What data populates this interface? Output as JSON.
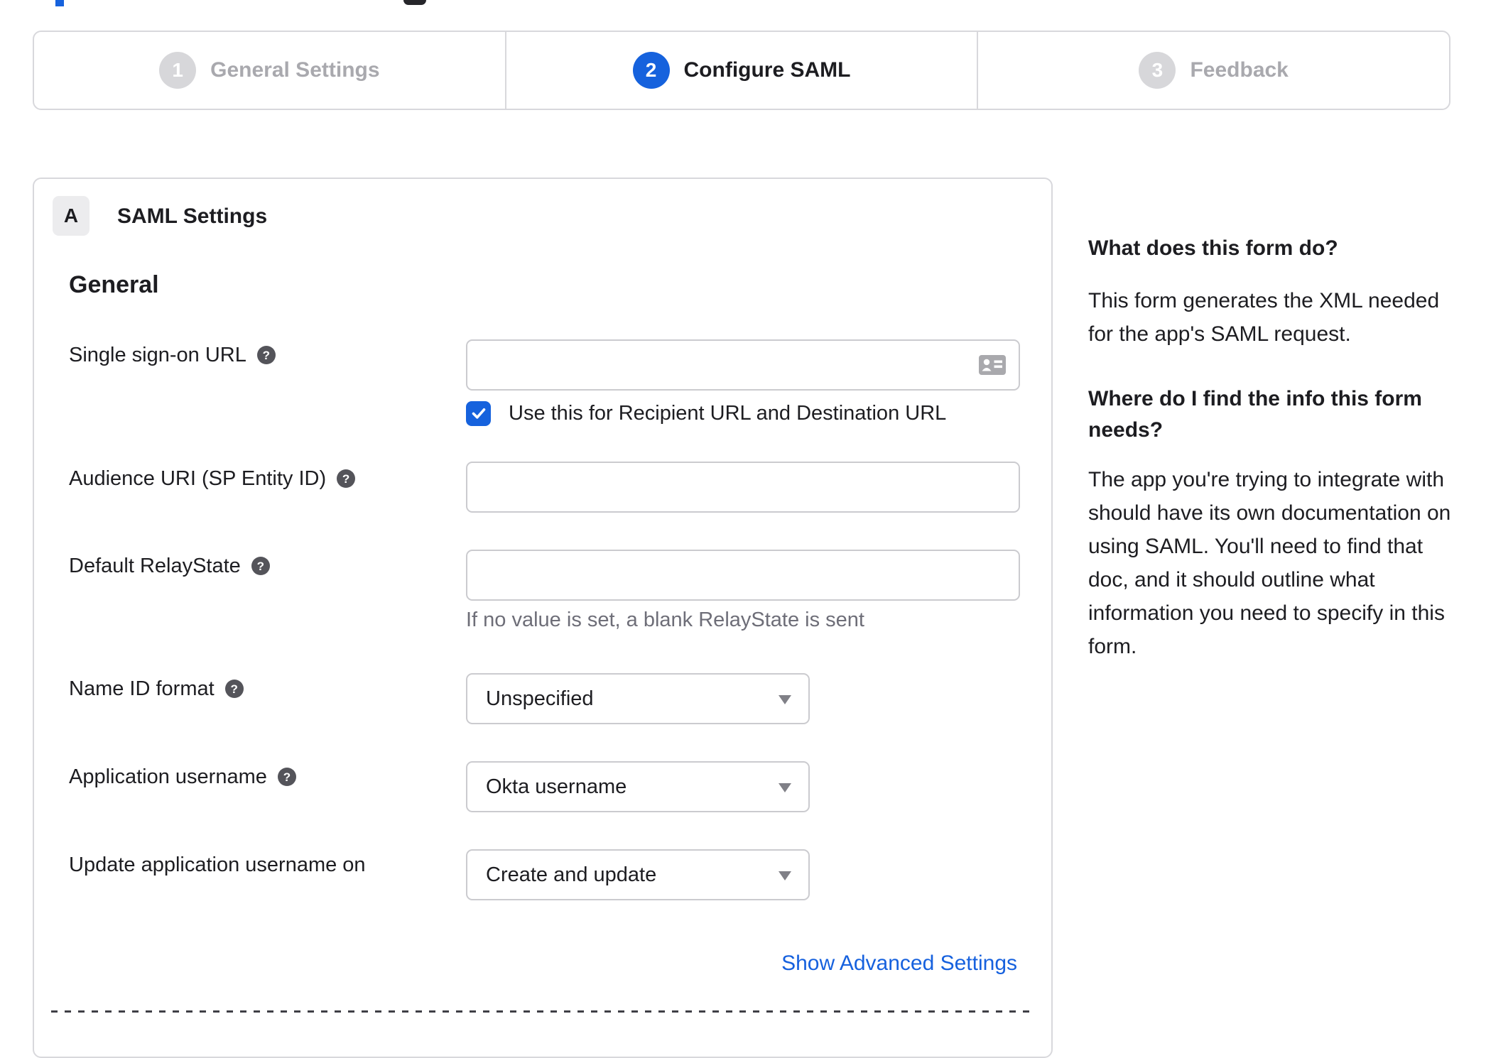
{
  "colors": {
    "accent_blue": "#1662dd",
    "link_blue": "#1661de",
    "inactive_gray": "#a9a9ae",
    "text_dark": "#1d1d21",
    "hint_gray": "#6e6e78"
  },
  "stepper": {
    "steps": [
      {
        "number": "1",
        "label": "General Settings",
        "state": "inactive"
      },
      {
        "number": "2",
        "label": "Configure SAML",
        "state": "active"
      },
      {
        "number": "3",
        "label": "Feedback",
        "state": "inactive"
      }
    ]
  },
  "panel": {
    "section_letter": "A",
    "section_title": "SAML Settings",
    "group_heading": "General",
    "fields": {
      "sso": {
        "label": "Single sign-on URL",
        "value": "",
        "checkbox_label": "Use this for Recipient URL and Destination URL",
        "checkbox_checked": true
      },
      "audience": {
        "label": "Audience URI (SP Entity ID)",
        "value": ""
      },
      "relay": {
        "label": "Default RelayState",
        "value": "",
        "hint": "If no value is set, a blank RelayState is sent"
      },
      "nameid": {
        "label": "Name ID format",
        "value": "Unspecified"
      },
      "appuser": {
        "label": "Application username",
        "value": "Okta username"
      },
      "update": {
        "label": "Update application username on",
        "value": "Create and update"
      }
    },
    "advanced_link": "Show Advanced Settings"
  },
  "sidebar": {
    "q1": "What does this form do?",
    "a1": "This form generates the XML needed for the app's SAML request.",
    "q2": "Where do I find the info this form needs?",
    "a2": "The app you're trying to integrate with should have its own documentation on using SAML. You'll need to find that doc, and it should outline what information you need to specify in this form."
  }
}
